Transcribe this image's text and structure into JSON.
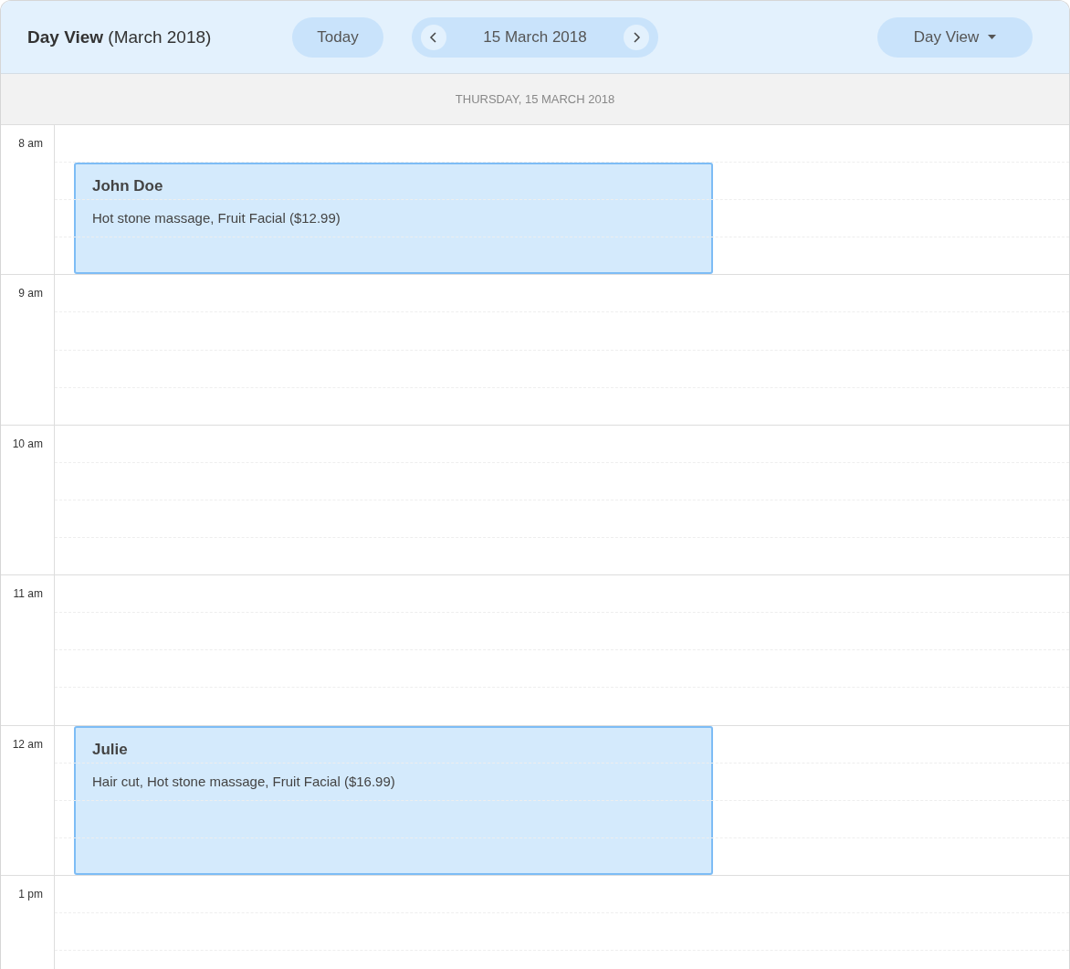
{
  "header": {
    "title": "Day View",
    "subtitle": "(March 2018)",
    "today_button": "Today",
    "date": "15 March 2018",
    "view_select": "Day View"
  },
  "day_heading": "THURSDAY, 15 MARCH 2018",
  "hours": [
    {
      "label": "8 am"
    },
    {
      "label": "9 am"
    },
    {
      "label": "10 am"
    },
    {
      "label": "11 am"
    },
    {
      "label": "12 am"
    },
    {
      "label": "1 pm"
    }
  ],
  "appointments": [
    {
      "title": "John Doe",
      "details": "Hot stone massage, Fruit Facial ($12.99)"
    },
    {
      "title": "Julie",
      "details": "Hair cut, Hot stone massage, Fruit Facial ($16.99)"
    }
  ]
}
